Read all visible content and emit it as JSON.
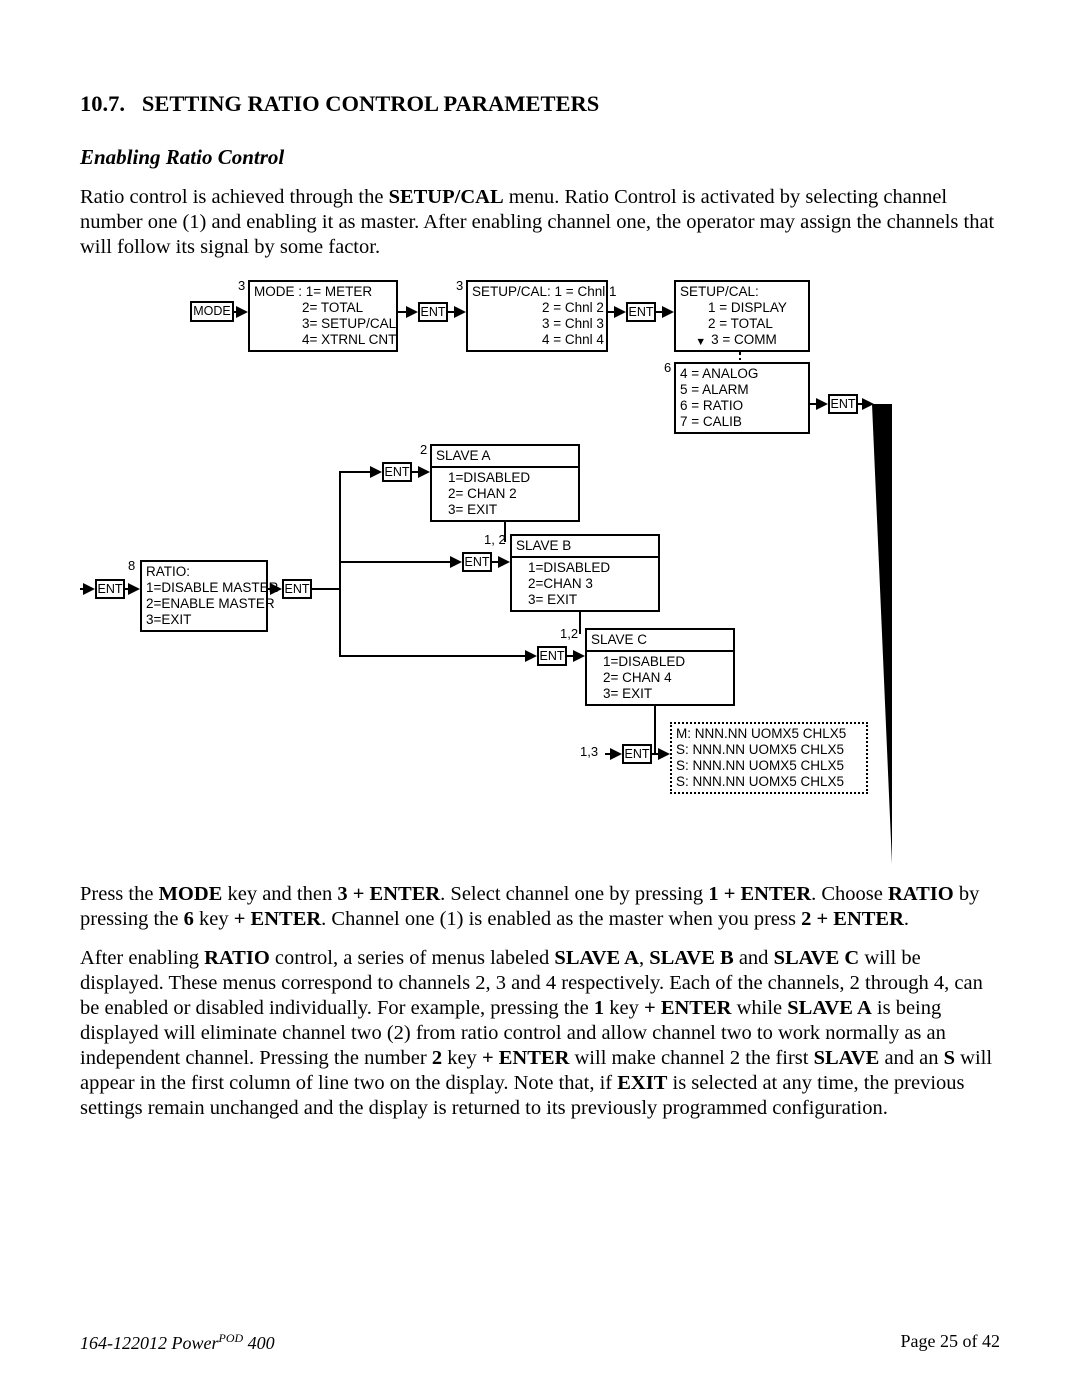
{
  "section_number": "10.7.",
  "section_title": "SETTING RATIO CONTROL PARAMETERS",
  "subtitle": "Enabling Ratio Control",
  "intro": {
    "pre": "Ratio control is achieved through the ",
    "menu": "SETUP/CAL",
    "post": " menu.  Ratio Control is activated by selecting channel number one (1) and enabling it as master.  After enabling channel one, the operator may assign the channels that will follow its signal by some factor."
  },
  "diagram": {
    "mode_btn": "MODE",
    "ent_btn": "ENT",
    "menu_mode": {
      "title": "MODE :",
      "items": [
        "1= METER",
        "2= TOTAL",
        "3= SETUP/CAL",
        "4= XTRNL CNT"
      ],
      "corner": "3"
    },
    "menu_setupcal_ch": {
      "title": "SETUP/CAL:",
      "items": [
        "1 = Chnl 1",
        "2 = Chnl 2",
        "3 = Chnl 3",
        "4 = Chnl 4"
      ],
      "corner": "3"
    },
    "menu_setupcal_opts": {
      "title": "SETUP/CAL:",
      "items": [
        "1 = DISPLAY",
        "2 = TOTAL",
        "3 = COMM",
        "4 = ANALOG",
        "5 = ALARM",
        "6 = RATIO",
        "7 = CALIB"
      ],
      "corner": "6"
    },
    "menu_ratio": {
      "title": "RATIO:",
      "items": [
        "1=DISABLE MASTER",
        "2=ENABLE MASTER",
        "3=EXIT"
      ],
      "corner": "8"
    },
    "menu_slave_a": {
      "title": "SLAVE A",
      "items": [
        "1=DISABLED",
        "2= CHAN 2",
        "3= EXIT"
      ],
      "corner": "2"
    },
    "menu_slave_b": {
      "title": "SLAVE B",
      "items": [
        "1=DISABLED",
        "2=CHAN 3",
        "3= EXIT"
      ],
      "corner": "1, 2"
    },
    "menu_slave_c": {
      "title": "SLAVE C",
      "items": [
        "1=DISABLED",
        "2= CHAN 4",
        "3= EXIT"
      ],
      "corner": "1,2"
    },
    "display_final": [
      "M: NNN.NN  UOMX5  CHLX5",
      "S: NNN.NN  UOMX5  CHLX5",
      "S: NNN.NN  UOMX5  CHLX5",
      "S: NNN.NN  UOMX5  CHLX5"
    ],
    "display_corner": "1,3"
  },
  "para2": {
    "t1": "Press the ",
    "b1": "MODE",
    "t2": " key and then ",
    "b2": "3 + ENTER",
    "t3": ".  Select channel one by pressing ",
    "b3": "1 + ENTER",
    "t4": ".  Choose ",
    "b4": "RATIO",
    "t5": " by pressing the ",
    "b5": "6",
    "t6": " key ",
    "b6": "+ ENTER",
    "t7": ".  Channel one (1) is enabled as the master when you press ",
    "b7": "2 + ENTER",
    "t8": "."
  },
  "para3": {
    "t1": "After enabling ",
    "b1": "RATIO",
    "t2": " control, a series of menus labeled ",
    "b2": "SLAVE A",
    "t3": ", ",
    "b3": "SLAVE B",
    "t4": " and ",
    "b4": "SLAVE C",
    "t5": " will be displayed.  These menus correspond to channels 2, 3 and 4 respectively.  Each of the channels, 2 through 4, can be enabled or disabled individually.  For example, pressing the ",
    "b5": "1",
    "t6": " key ",
    "b6": "+ ENTER",
    "t7": " while ",
    "b7": "SLAVE A",
    "t8": " is being displayed will eliminate channel two (2) from ratio control and allow channel two to work normally as an independent channel.  Pressing the number ",
    "b8": "2",
    "t9": " key ",
    "b9": "+ ENTER",
    "t10": " will make channel 2 the first ",
    "b10": "SLAVE",
    "t11": " and an ",
    "b11": "S",
    "t12": " will appear in the first column of line two on the display.  Note that, if ",
    "b12": "EXIT",
    "t13": " is selected at any time, the previous settings remain unchanged and the display is returned to its previously programmed configuration."
  },
  "footer": {
    "left_a": "164-122012 Power",
    "left_pod": "POD",
    "left_b": " 400",
    "right": "Page 25 of 42"
  }
}
